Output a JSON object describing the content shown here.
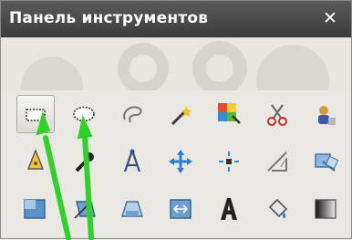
{
  "panel": {
    "title": "Панель инструментов",
    "close_glyph": "✕"
  },
  "tools": [
    {
      "name": "rect-select-icon",
      "active": true
    },
    {
      "name": "ellipse-select-icon"
    },
    {
      "name": "free-select-icon"
    },
    {
      "name": "fuzzy-select-icon"
    },
    {
      "name": "select-by-color-icon"
    },
    {
      "name": "scissors-select-icon"
    },
    {
      "name": "foreground-select-icon"
    },
    {
      "name": "paths-icon"
    },
    {
      "name": "color-picker-icon"
    },
    {
      "name": "measure-icon"
    },
    {
      "name": "move-icon"
    },
    {
      "name": "alignment-icon"
    },
    {
      "name": "crop-icon"
    },
    {
      "name": "rotate-icon"
    },
    {
      "name": "scale-icon"
    },
    {
      "name": "shear-icon"
    },
    {
      "name": "perspective-icon"
    },
    {
      "name": "flip-icon"
    },
    {
      "name": "text-icon"
    },
    {
      "name": "bucket-fill-icon"
    },
    {
      "name": "blend-icon"
    }
  ],
  "colors": {
    "titlebar": "#474747",
    "arrow": "#2fd12b"
  }
}
